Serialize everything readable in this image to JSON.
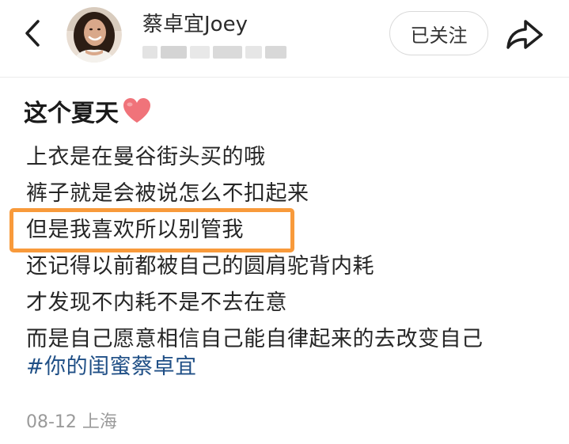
{
  "header": {
    "back_icon": "chevron-left-icon",
    "avatar_icon": "user-avatar",
    "username": "蔡卓宜Joey",
    "follow_label": "已关注",
    "share_icon": "share-arrow-icon"
  },
  "post": {
    "title": "这个夏天",
    "title_emoji": "red-heart-emoji",
    "lines": [
      "上衣是在曼谷街头买的哦",
      "裤子就是会被说怎么不扣起来",
      "但是我喜欢所以别管我",
      "还记得以前都被自己的圆肩驼背内耗",
      "才发现不内耗不是不去在意",
      "而是自己愿意相信自己能自律起来的去改变自己"
    ],
    "hashtag": "#你的闺蜜蔡卓宜",
    "meta": "08-12 上海"
  },
  "colors": {
    "highlight": "#f89a3b",
    "hashtag": "#1f4f86",
    "heart": "#f0737a",
    "meta": "#9a9a9a"
  }
}
